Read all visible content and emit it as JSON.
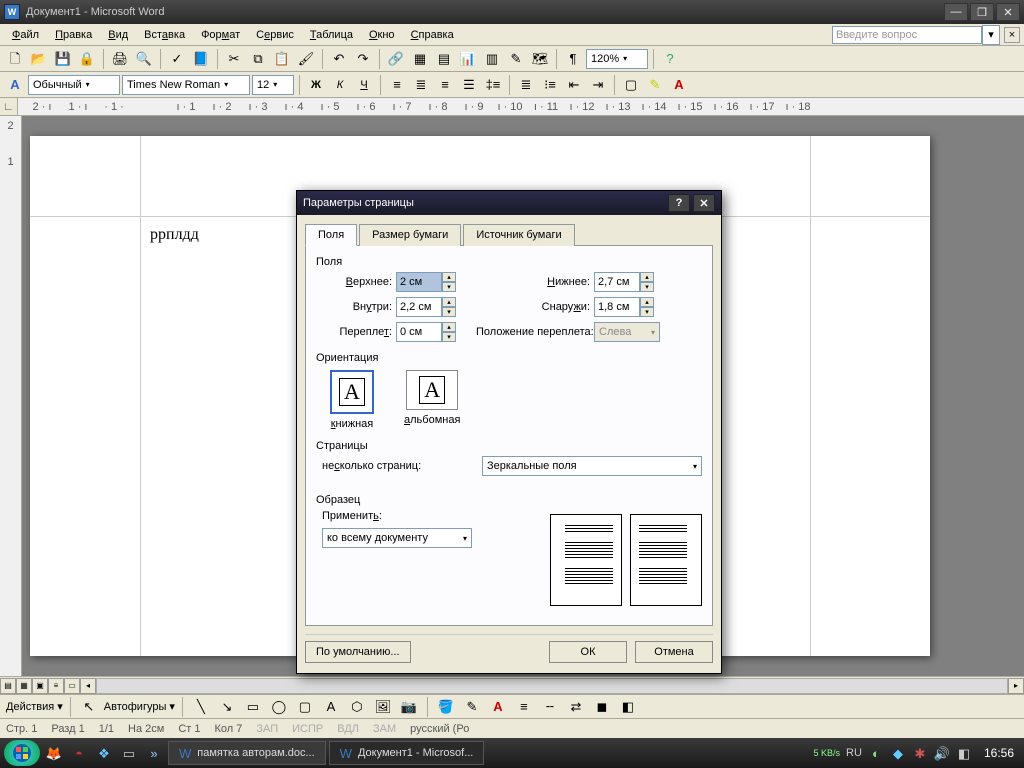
{
  "titlebar": {
    "text": "Документ1 - Microsoft Word"
  },
  "menu": {
    "file": "Файл",
    "edit": "Правка",
    "view": "Вид",
    "insert": "Вставка",
    "format": "Формат",
    "service": "Сервис",
    "table": "Таблица",
    "window": "Окно",
    "help": "Справка",
    "askbox": "Введите вопрос"
  },
  "std_toolbar": {
    "zoom": "120%"
  },
  "fmt_toolbar": {
    "style_label": "Обычный",
    "font": "Times New Roman",
    "size": "12",
    "bold": "Ж",
    "italic": "К",
    "underline": "Ч"
  },
  "ruler_h": [
    "2",
    "1",
    "1",
    "",
    "1",
    "2",
    "3",
    "4",
    "5",
    "6",
    "7",
    "8",
    "9",
    "10",
    "11",
    "12",
    "13",
    "14",
    "15",
    "16",
    "17",
    "18"
  ],
  "ruler_v": [
    "2",
    "1"
  ],
  "document": {
    "text": "ррплдд"
  },
  "drawbar": {
    "actions": "Действия",
    "autoshapes": "Автофигуры"
  },
  "status": {
    "page": "Стр. 1",
    "sec": "Разд 1",
    "pages": "1/1",
    "at": "На 2см",
    "line": "Ст 1",
    "col": "Кол 7",
    "rec": "ЗАП",
    "trk": "ИСПР",
    "ext": "ВДЛ",
    "ovr": "ЗАМ",
    "lang": "русский (Ро"
  },
  "dialog": {
    "title": "Параметры страницы",
    "tabs": {
      "fields": "Поля",
      "paper": "Размер бумаги",
      "source": "Источник бумаги"
    },
    "group_fields": "Поля",
    "lbl_top": "Верхнее:",
    "val_top": "2 см",
    "lbl_bottom": "Нижнее:",
    "val_bottom": "2,7 см",
    "lbl_inside": "Внутри:",
    "val_inside": "2,2 см",
    "lbl_outside": "Снаружи:",
    "val_outside": "1,8 см",
    "lbl_gutter": "Переплет:",
    "val_gutter": "0 см",
    "lbl_gutter_pos": "Положение переплета:",
    "val_gutter_pos": "Слева",
    "group_orientation": "Ориентация",
    "ori_portrait": "книжная",
    "ori_landscape": "альбомная",
    "group_pages": "Страницы",
    "lbl_multi": "несколько страниц:",
    "val_multi": "Зеркальные поля",
    "group_preview": "Образец",
    "lbl_apply": "Применить:",
    "val_apply": "ко всему документу",
    "btn_default": "По умолчанию...",
    "btn_ok": "ОК",
    "btn_cancel": "Отмена"
  },
  "taskbar": {
    "task1": "памятка авторам.doc...",
    "task2": "Документ1 - Microsof...",
    "net_label": "5 KB/s",
    "kb": "RU",
    "clock": "16:56"
  }
}
